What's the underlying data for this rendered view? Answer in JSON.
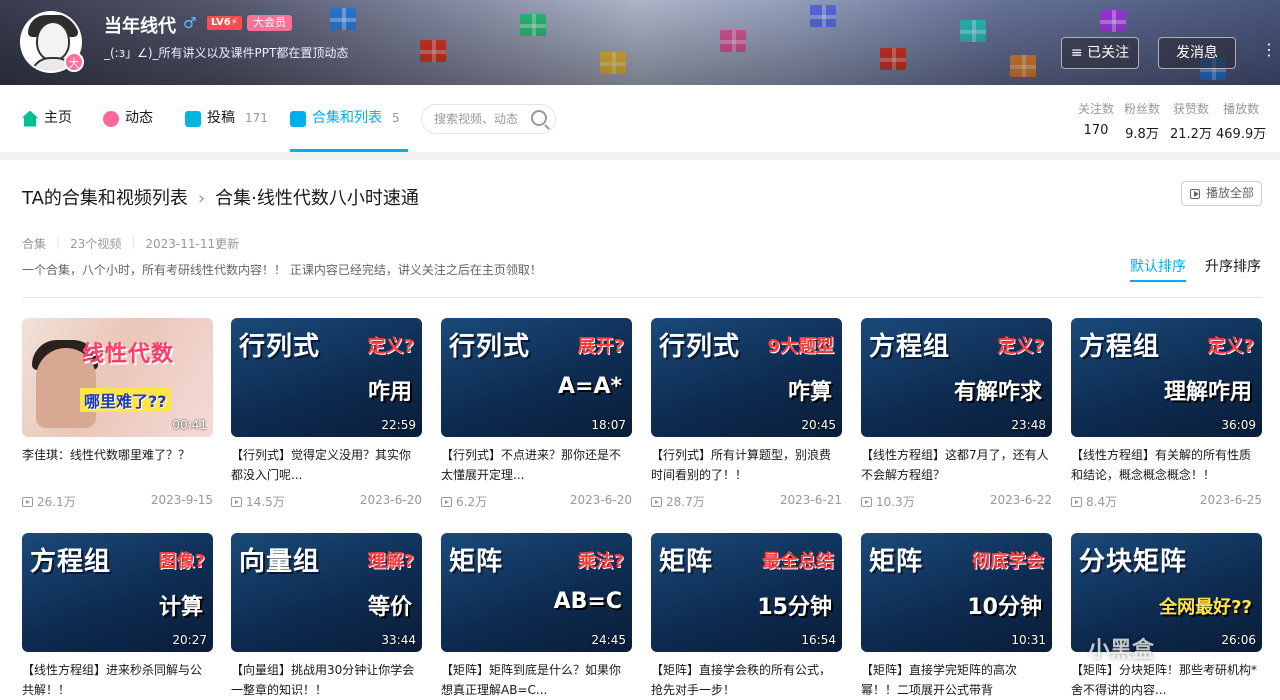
{
  "header": {
    "username": "当年线代",
    "gender_icon": "♂",
    "level": "LV6⚡",
    "vip_label": "大会员",
    "avatar_badge": "大",
    "signature": "_(:з」∠)_所有讲义以及课件PPT都在置顶动态",
    "follow_button": "≡ 已关注",
    "message_button": "发消息",
    "more_icon": "⋮"
  },
  "nav": {
    "home": "主页",
    "dynamic": "动态",
    "submit": "投稿",
    "submit_count": "171",
    "collections": "合集和列表",
    "collections_count": "5",
    "search_placeholder": "搜索视频、动态"
  },
  "stats": [
    {
      "label": "关注数",
      "value": "170"
    },
    {
      "label": "粉丝数",
      "value": "9.8万"
    },
    {
      "label": "获赞数",
      "value": "21.2万"
    },
    {
      "label": "播放数",
      "value": "469.9万"
    }
  ],
  "collection": {
    "breadcrumb_root": "TA的合集和视频列表",
    "breadcrumb_sep": "›",
    "title": "合集·线性代数八小时速通",
    "play_all": "播放全部",
    "type": "合集",
    "video_count": "23个视频",
    "updated": "2023-11-11更新",
    "description": "一个合集，八个小时，所有考研线性代数内容！！ 正课内容已经完结，讲义关注之后在主页领取！",
    "sort_default": "默认排序",
    "sort_order": "升序排序"
  },
  "videos": [
    {
      "t1": "线性代数",
      "t2": "",
      "t3": "哪里难了??",
      "duration": "00:41",
      "title": "李佳琪：线性代数哪里难了？？",
      "views": "26.1万",
      "date": "2023-9-15"
    },
    {
      "t1": "行列式",
      "t2": "定义?",
      "t3": "咋用",
      "duration": "22:59",
      "title": "【行列式】觉得定义没用？其实你都没入门呢...",
      "views": "14.5万",
      "date": "2023-6-20"
    },
    {
      "t1": "行列式",
      "t2": "展开?",
      "t3": "A=A*",
      "duration": "18:07",
      "title": "【行列式】不点进来？那你还是不太懂展开定理...",
      "views": "6.2万",
      "date": "2023-6-20"
    },
    {
      "t1": "行列式",
      "t2": "9大题型",
      "t3": "咋算",
      "duration": "20:45",
      "title": "【行列式】所有计算题型，别浪费时间看别的了！！",
      "views": "28.7万",
      "date": "2023-6-21"
    },
    {
      "t1": "方程组",
      "t2": "定义?",
      "t3": "有解咋求",
      "duration": "23:48",
      "title": "【线性方程组】这都7月了，还有人不会解方程组？",
      "views": "10.3万",
      "date": "2023-6-22"
    },
    {
      "t1": "方程组",
      "t2": "定义?",
      "t3": "理解咋用",
      "duration": "36:09",
      "title": "【线性方程组】有关解的所有性质和结论，概念概念概念！！",
      "views": "8.4万",
      "date": "2023-6-25"
    },
    {
      "t1": "方程组",
      "t2": "图像?",
      "t3": "计算",
      "duration": "20:27",
      "title": "【线性方程组】进来秒杀同解与公共解！！",
      "views": "",
      "date": ""
    },
    {
      "t1": "向量组",
      "t2": "理解?",
      "t3": "等价",
      "duration": "33:44",
      "title": "【向量组】挑战用30分钟让你学会一整章的知识！！",
      "views": "",
      "date": ""
    },
    {
      "t1": "矩阵",
      "t2": "乘法?",
      "t3": "AB=C",
      "duration": "24:45",
      "title": "【矩阵】矩阵到底是什么？如果你想真正理解AB=C...",
      "views": "",
      "date": ""
    },
    {
      "t1": "矩阵",
      "t2": "最全总结",
      "t3": "15分钟",
      "duration": "16:54",
      "title": "【矩阵】直接学会秩的所有公式，抢先对手一步！",
      "views": "",
      "date": ""
    },
    {
      "t1": "矩阵",
      "t2": "彻底学会",
      "t3": "10分钟",
      "duration": "10:31",
      "title": "【矩阵】直接学完矩阵的高次幂！！二项展开公式带背",
      "views": "",
      "date": ""
    },
    {
      "t1": "分块矩阵",
      "t2": "",
      "t3": "全网最好??",
      "duration": "26:06",
      "title": "【矩阵】分块矩阵！那些考研机构*舍不得讲的内容...",
      "views": "",
      "date": ""
    }
  ],
  "watermark": "小黑盒"
}
